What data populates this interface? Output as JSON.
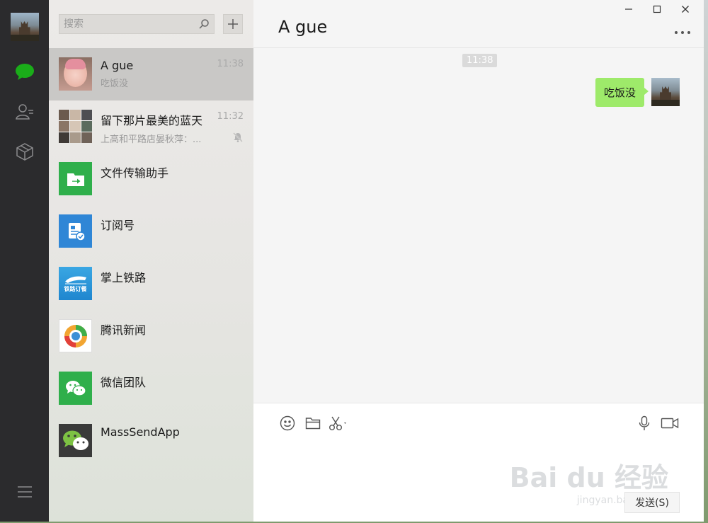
{
  "search": {
    "placeholder": "搜索"
  },
  "conversations": [
    {
      "name": "A gue",
      "preview": "吃饭没",
      "time": "11:38",
      "avatar": "baby-photo",
      "selected": true
    },
    {
      "name": "留下那片最美的蓝天",
      "preview": "上高和平路店晏秋萍：...",
      "time": "11:32",
      "avatar": "group-collage",
      "muted": true
    },
    {
      "name": "文件传输助手",
      "avatar": "file-transfer-icon"
    },
    {
      "name": "订阅号",
      "avatar": "subscription-icon"
    },
    {
      "name": "掌上铁路",
      "avatar": "railway-icon",
      "avatar_text": "铁路订餐"
    },
    {
      "name": "腾讯新闻",
      "avatar": "tencent-news-icon"
    },
    {
      "name": "微信团队",
      "avatar": "wechat-team-icon"
    },
    {
      "name": "MassSendApp",
      "avatar": "mass-send-icon"
    }
  ],
  "chat": {
    "title": "A gue",
    "timestamp": "11:38",
    "messages": [
      {
        "text": "吃饭没",
        "from": "me"
      }
    ],
    "send_label": "发送(S)"
  },
  "watermark": {
    "brand": "Bai du 经验",
    "url": "jingyan.baidu.com"
  },
  "colors": {
    "accent": "#2faf4b",
    "bubble": "#9eea6a",
    "nav_bg": "#2b2b2d"
  }
}
